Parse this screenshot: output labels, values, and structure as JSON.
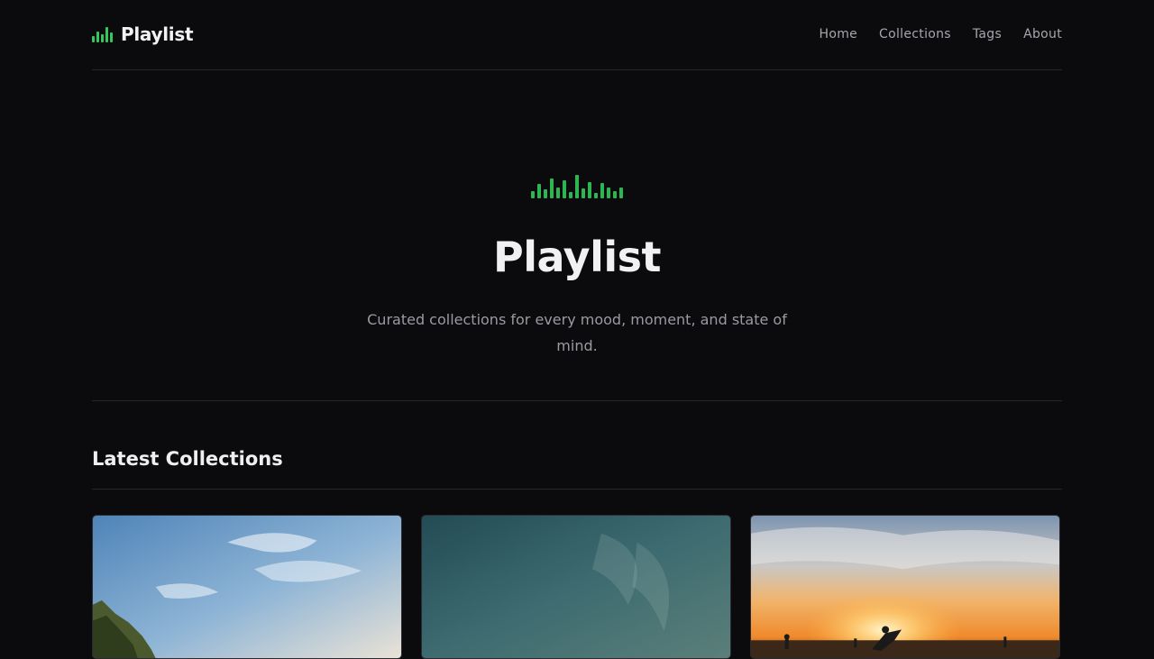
{
  "site": {
    "logo_text": "Playlist",
    "accent_color": "#34c759"
  },
  "nav": {
    "items": [
      "Home",
      "Collections",
      "Tags",
      "About"
    ]
  },
  "hero": {
    "title": "Playlist",
    "subtitle": "Curated collections for every mood, moment, and state of mind."
  },
  "section": {
    "title": "Latest Collections"
  },
  "cards": [
    {
      "image": "sky-cliff-photo"
    },
    {
      "image": "teal-sky-photo"
    },
    {
      "image": "beach-sunset-photo"
    }
  ]
}
